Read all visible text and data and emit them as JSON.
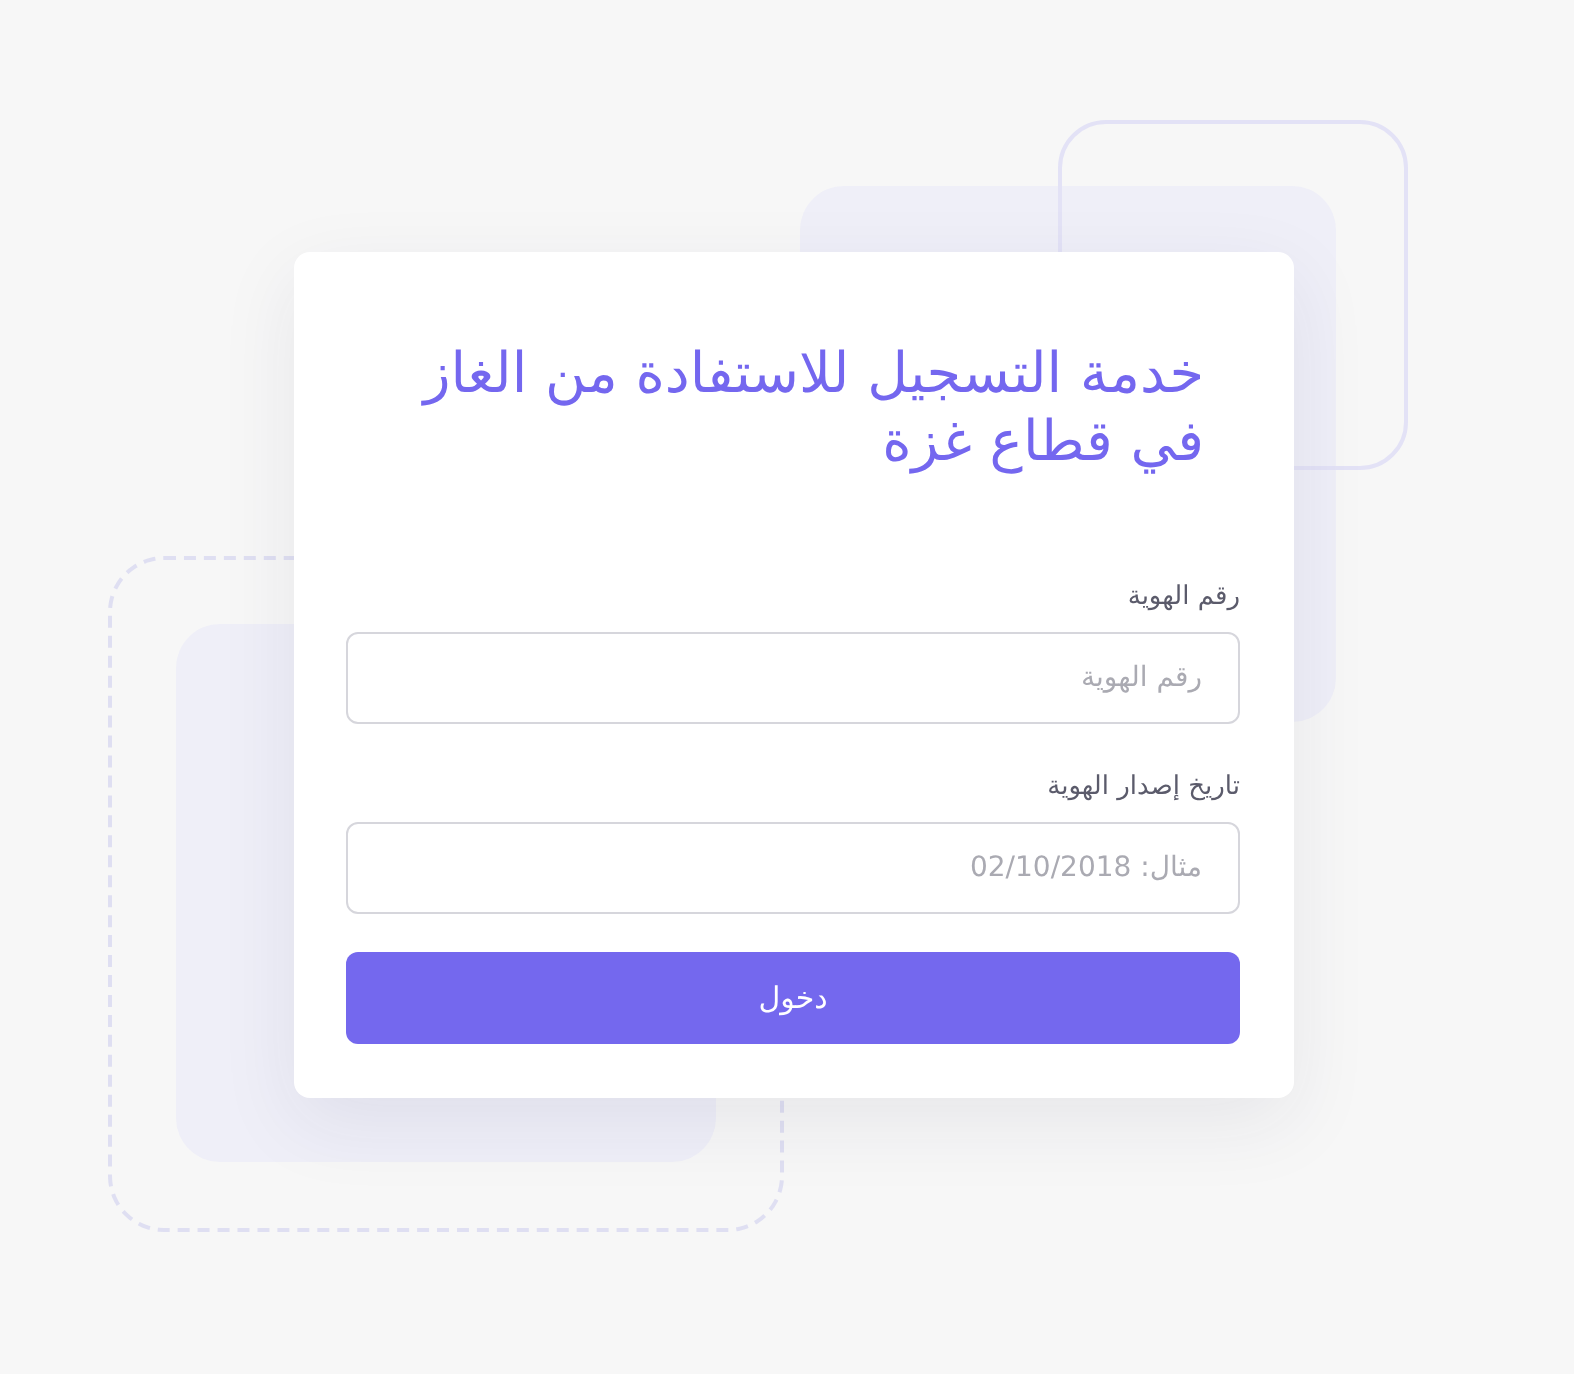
{
  "title": "خدمة التسجيل للاستفادة من الغاز في قطاع غزة",
  "fields": [
    {
      "label": "رقم الهوية",
      "placeholder": "رقم الهوية"
    },
    {
      "label": "تاريخ إصدار الهوية",
      "placeholder": "مثال: 02/10/2018"
    }
  ],
  "submit_button": {
    "label": "دخول"
  }
}
